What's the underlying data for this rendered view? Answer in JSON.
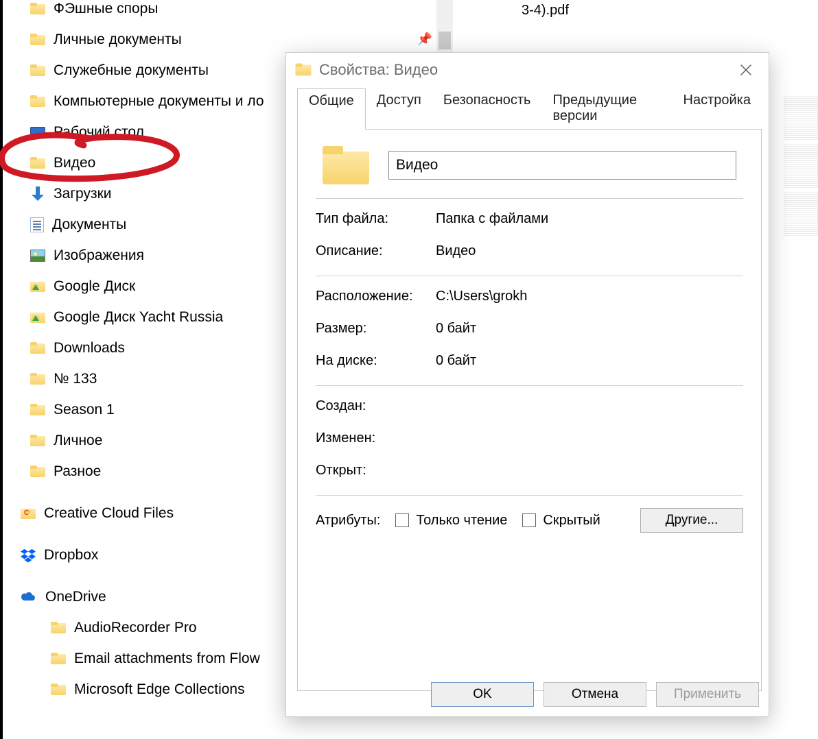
{
  "sidebar": {
    "items": [
      {
        "label": "ФЭшные споры",
        "icon": "folder",
        "pinned": false
      },
      {
        "label": "Личные документы",
        "icon": "folder",
        "pinned": true
      },
      {
        "label": "Служебные документы",
        "icon": "folder",
        "pinned": false
      },
      {
        "label": "Компьютерные документы и ло",
        "icon": "folder",
        "pinned": false
      },
      {
        "label": "Рабочий стол",
        "icon": "desktop",
        "pinned": false
      },
      {
        "label": "Видео",
        "icon": "folder",
        "pinned": false,
        "highlighted": true
      },
      {
        "label": "Загрузки",
        "icon": "download",
        "pinned": false
      },
      {
        "label": "Документы",
        "icon": "document",
        "pinned": false
      },
      {
        "label": "Изображения",
        "icon": "pictures",
        "pinned": false
      },
      {
        "label": "Google Диск",
        "icon": "folder-gdrive",
        "pinned": false
      },
      {
        "label": "Google Диск Yacht Russia",
        "icon": "folder-gdrive",
        "pinned": false
      },
      {
        "label": "Downloads",
        "icon": "folder",
        "pinned": false
      },
      {
        "label": "№ 133",
        "icon": "folder",
        "pinned": false
      },
      {
        "label": "Season 1",
        "icon": "folder",
        "pinned": false
      },
      {
        "label": "Личное",
        "icon": "folder",
        "pinned": false
      },
      {
        "label": "Разное",
        "icon": "folder",
        "pinned": false
      }
    ],
    "sections": [
      {
        "label": "Creative Cloud Files",
        "icon": "folder-cc"
      },
      {
        "label": "Dropbox",
        "icon": "dropbox"
      },
      {
        "label": "OneDrive",
        "icon": "onedrive"
      },
      {
        "children": [
          {
            "label": "AudioRecorder Pro",
            "icon": "folder"
          },
          {
            "label": "Email attachments from Flow",
            "icon": "folder"
          },
          {
            "label": "Microsoft Edge Collections",
            "icon": "folder"
          }
        ]
      }
    ]
  },
  "file_hint": "3-4).pdf",
  "dialog": {
    "title": "Свойства: Видео",
    "tabs": [
      "Общие",
      "Доступ",
      "Безопасность",
      "Предыдущие версии",
      "Настройка"
    ],
    "active_tab": 0,
    "name_value": "Видео",
    "rows": {
      "type_label": "Тип файла:",
      "type_value": "Папка с файлами",
      "desc_label": "Описание:",
      "desc_value": "Видео",
      "loc_label": "Расположение:",
      "loc_value": "C:\\Users\\grokh",
      "size_label": "Размер:",
      "size_value": "0 байт",
      "disk_label": "На диске:",
      "disk_value": "0 байт",
      "created_label": "Создан:",
      "created_value": "",
      "modified_label": "Изменен:",
      "modified_value": "",
      "opened_label": "Открыт:",
      "opened_value": ""
    },
    "attributes": {
      "label": "Атрибуты:",
      "readonly": "Только чтение",
      "hidden": "Скрытый",
      "other_btn": "Другие..."
    },
    "buttons": {
      "ok": "OK",
      "cancel": "Отмена",
      "apply": "Применить"
    }
  },
  "annotation": {
    "type": "circle",
    "color": "#cf1a26"
  }
}
